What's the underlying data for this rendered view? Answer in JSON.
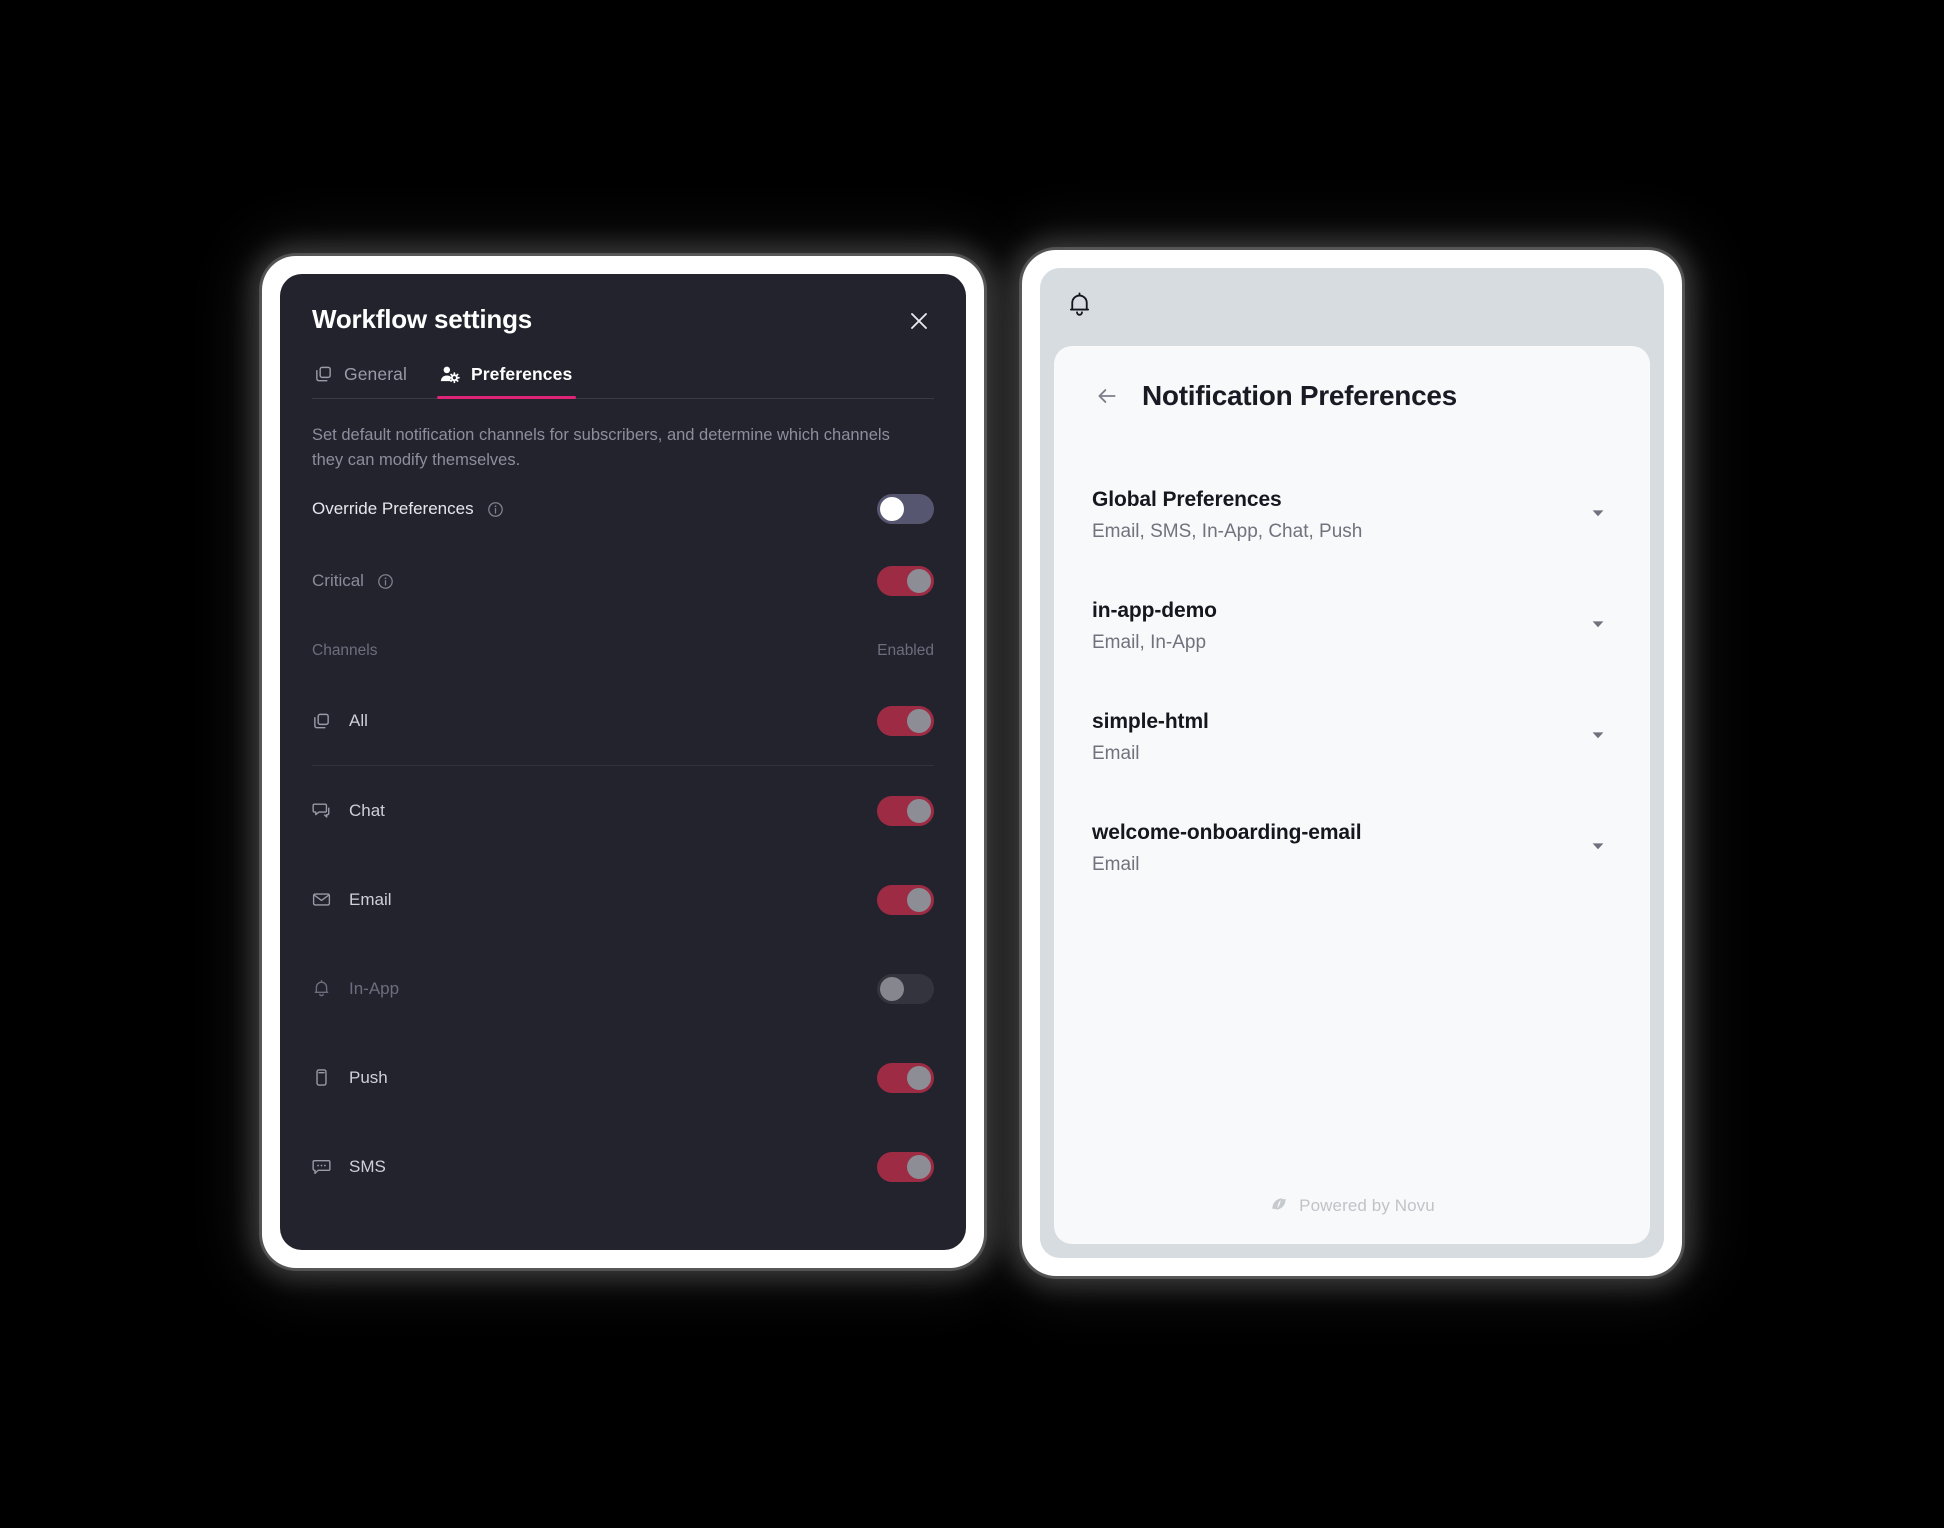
{
  "theme": {
    "accent_pink": "#DD2476",
    "panel_dark_bg": "#23232e",
    "toggle_on_track": "#9E2B44",
    "toggle_off_track": "#565670",
    "inbox_shell_bg": "#D6DCE0",
    "inbox_card_bg": "#F8F9FA"
  },
  "workflow_settings": {
    "title": "Workflow settings",
    "close_label": "✕",
    "tabs": [
      {
        "label": "General",
        "icon": "layers-icon",
        "active": false
      },
      {
        "label": "Preferences",
        "icon": "user-gear-icon",
        "active": true
      }
    ],
    "description": "Set default notification channels for subscribers, and determine which channels they can modify themselves.",
    "settings": [
      {
        "label": "Override Preferences",
        "info": true,
        "state": "off",
        "muted": false
      },
      {
        "label": "Critical",
        "info": true,
        "state": "on",
        "muted": true
      }
    ],
    "channels_header": {
      "left": "Channels",
      "right": "Enabled"
    },
    "channels": [
      {
        "label": "All",
        "icon": "layers-icon",
        "state": "on",
        "dim": false
      },
      {
        "label": "Chat",
        "icon": "chat-icon",
        "state": "on",
        "dim": false
      },
      {
        "label": "Email",
        "icon": "envelope-icon",
        "state": "on",
        "dim": false
      },
      {
        "label": "In-App",
        "icon": "bell-icon",
        "state": "off",
        "dim": true
      },
      {
        "label": "Push",
        "icon": "phone-icon",
        "state": "on",
        "dim": false
      },
      {
        "label": "SMS",
        "icon": "sms-icon",
        "state": "on",
        "dim": false
      }
    ]
  },
  "inbox": {
    "topbar_icon": "bell-icon",
    "back_icon": "arrow-left-icon",
    "title": "Notification Preferences",
    "preferences": [
      {
        "name": "Global Preferences",
        "channels": "Email, SMS, In-App, Chat, Push"
      },
      {
        "name": "in-app-demo",
        "channels": "Email, In-App"
      },
      {
        "name": "simple-html",
        "channels": "Email"
      },
      {
        "name": "welcome-onboarding-email",
        "channels": "Email"
      }
    ],
    "footer": {
      "icon": "novu-logo-icon",
      "text": "Powered by Novu"
    }
  }
}
